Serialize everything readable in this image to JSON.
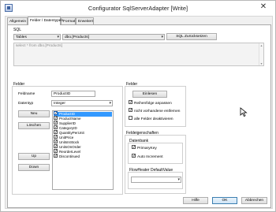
{
  "window": {
    "title": "Configurator SqlServerAdapter [Write]",
    "close_glyph": "✕"
  },
  "tabs": [
    {
      "label": "Allgemein",
      "active": false
    },
    {
      "label": "Felder / Datentypen",
      "active": true
    },
    {
      "label": "Format",
      "active": false
    },
    {
      "label": "Erweitert",
      "active": false
    }
  ],
  "sql": {
    "group_label": "SQL",
    "type_combo": "Tables",
    "table_combo": "dbo.[Products]",
    "reset_button": "SQL Zurücksetzen",
    "query": "select * from dbo.[Products]"
  },
  "felder": {
    "group_label": "Felder",
    "feldname_label": "Feldname",
    "feldname_value": "ProductID",
    "datentyp_label": "Datentyp",
    "datentyp_value": "Integer",
    "neu_button": "Neu",
    "loeschen_button": "Löschen",
    "up_button": "Up",
    "down_button": "Down",
    "fields": [
      {
        "name": "ProductID",
        "checked": true,
        "selected": true
      },
      {
        "name": "ProductName",
        "checked": true,
        "selected": false
      },
      {
        "name": "SupplierID",
        "checked": true,
        "selected": false
      },
      {
        "name": "CategoryID",
        "checked": true,
        "selected": false
      },
      {
        "name": "QuantityPerUnit",
        "checked": true,
        "selected": false
      },
      {
        "name": "UnitPrice",
        "checked": true,
        "selected": false
      },
      {
        "name": "UnitsInStock",
        "checked": true,
        "selected": false
      },
      {
        "name": "UnitsOnOrder",
        "checked": true,
        "selected": false
      },
      {
        "name": "ReorderLevel",
        "checked": true,
        "selected": false
      },
      {
        "name": "Discontinued",
        "checked": true,
        "selected": false
      }
    ]
  },
  "felder_right": {
    "group_label": "Felder",
    "einlesen_button": "Einlesen",
    "options": [
      {
        "label": "Reihenfolge anpassen",
        "checked": true
      },
      {
        "label": "nicht vorhandene entfernen",
        "checked": true
      },
      {
        "label": "alle Felder deaktivieren",
        "checked": false
      }
    ]
  },
  "feldeigenschaften": {
    "group_label": "Feldeigenschaften",
    "datenbank_label": "Datenbank",
    "primary_key": {
      "label": "PrimaryKey",
      "checked": true
    },
    "auto_increment": {
      "label": "Auto Increment",
      "checked": true
    },
    "flowheater_label": "FlowHeater DefaultValue",
    "flowheater_value": ""
  },
  "footer": {
    "hilfe": "Hilfe",
    "ok": "OK",
    "abbrechen": "Abbrechen"
  },
  "icons": {
    "check": "✓",
    "dropdown": "▾",
    "scroll_up": "▴",
    "scroll_down": "▾"
  }
}
